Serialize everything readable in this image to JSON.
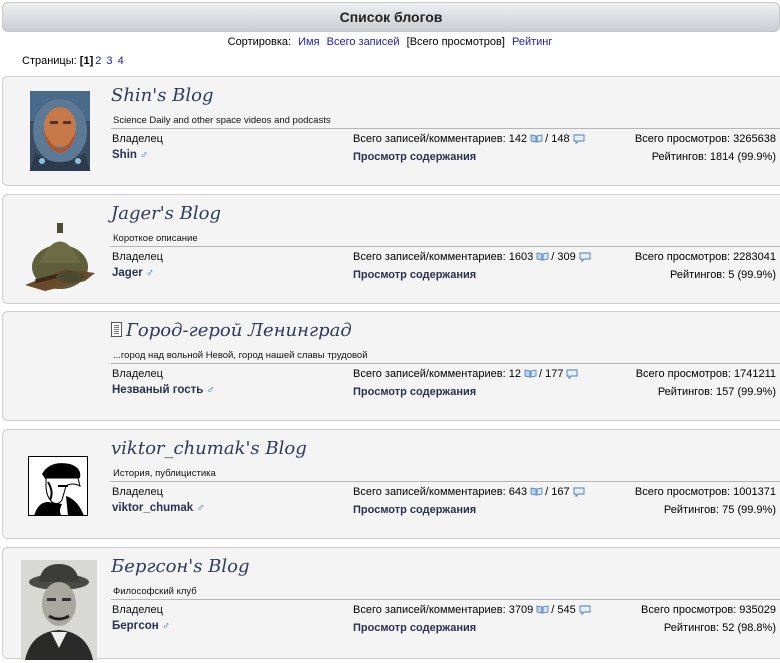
{
  "header": {
    "title": "Список блогов"
  },
  "sort": {
    "label": "Сортировка:",
    "options": [
      "Имя",
      "Всего записей",
      "Всего просмотров",
      "Рейтинг"
    ],
    "selected": "Всего просмотров"
  },
  "pager": {
    "label": "Страницы:",
    "current": "1",
    "pages": [
      "2",
      "3",
      "4"
    ]
  },
  "labels": {
    "owner": "Владелец",
    "posts_prefix": "Всего записей/комментариев:",
    "view_content": "Просмотр содержания",
    "views_prefix": "Всего просмотров:",
    "rating_prefix": "Рейтингов:"
  },
  "blogs": [
    {
      "title": "Shin's Blog",
      "description": "Science Daily and other space videos and podcasts",
      "owner": "Shin",
      "posts": "142",
      "comments": "148",
      "views": "3265638",
      "ratings": "1814",
      "rating_pct": "(99.9%)",
      "avatar": "astronaut-avatar"
    },
    {
      "title": "Jager's Blog",
      "description": "Короткое описание",
      "owner": "Jager",
      "posts": "1603",
      "comments": "309",
      "views": "2283041",
      "ratings": "5",
      "rating_pct": "(99.9%)",
      "avatar": "helmet-avatar"
    },
    {
      "title": "Город-герой Ленинград",
      "description": "...город над вольной Невой, город нашей славы трудовой",
      "owner": "Незваный гость",
      "posts": "12",
      "comments": "177",
      "views": "1741211",
      "ratings": "157",
      "rating_pct": "(99.9%)",
      "avatar": "none"
    },
    {
      "title": "viktor_chumak's Blog",
      "description": "История, публицистика",
      "owner": "viktor_chumak",
      "posts": "643",
      "comments": "167",
      "views": "1001371",
      "ratings": "75",
      "rating_pct": "(99.9%)",
      "avatar": "stencil-portrait-avatar"
    },
    {
      "title": "Бергсон's Blog",
      "description": "Философский клуб",
      "owner": "Бергсон",
      "posts": "3709",
      "comments": "545",
      "views": "935029",
      "ratings": "52",
      "rating_pct": "(98.8%)",
      "avatar": "vintage-portrait-avatar"
    }
  ],
  "icons": {
    "male": "♂",
    "book": "book-icon",
    "comment": "comment-bubble-icon",
    "feed": "feed-icon"
  },
  "colors": {
    "link": "#22229c",
    "title": "#2f3b5c",
    "male": "#3a78c8"
  }
}
